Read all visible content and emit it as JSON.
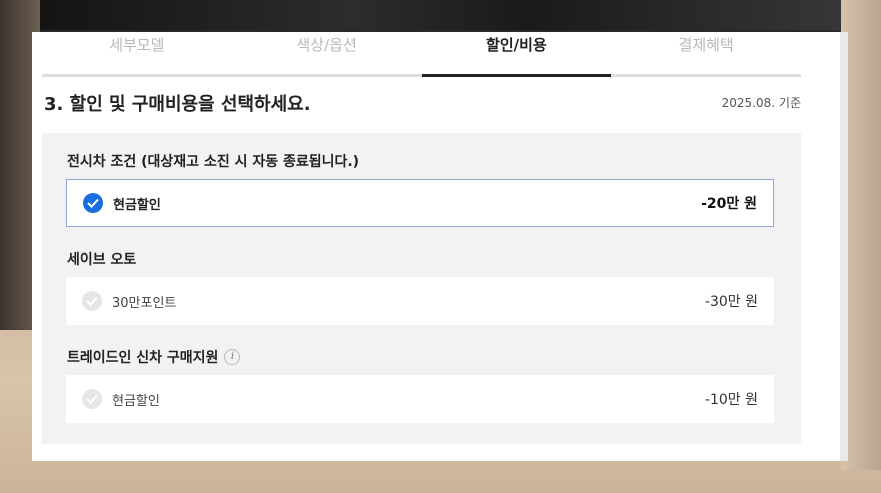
{
  "tabs": [
    {
      "label": "세부모델",
      "active": false
    },
    {
      "label": "색상/옵션",
      "active": false
    },
    {
      "label": "할인/비용",
      "active": true
    },
    {
      "label": "결제혜택",
      "active": false
    }
  ],
  "section": {
    "title": "3. 할인 및 구매비용을 선택하세요.",
    "date": "2025.08. 기준"
  },
  "groups": [
    {
      "title": "전시차 조건 (대상재고 소진 시 자동 종료됩니다.)",
      "option": {
        "label": "현금할인",
        "price": "-20만 원",
        "selected": true
      }
    },
    {
      "title": "세이브 오토",
      "option": {
        "label": "30만포인트",
        "price": "-30만 원",
        "selected": false
      }
    },
    {
      "title": "트레이드인 신차 구매지원",
      "info_icon": "i",
      "option": {
        "label": "현금할인",
        "price": "-10만 원",
        "selected": false
      }
    }
  ],
  "colors": {
    "accent": "#1a6fe0",
    "selected_border": "#8fa8d6",
    "box_bg": "#f2f2f2"
  }
}
